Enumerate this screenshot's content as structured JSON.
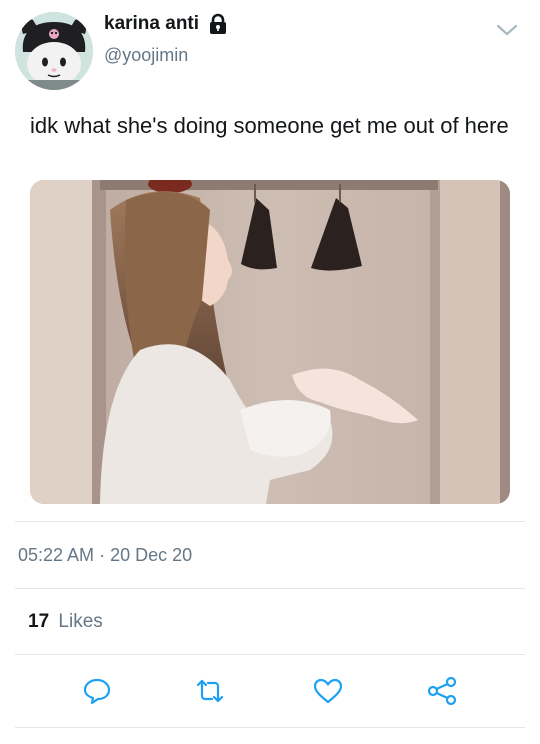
{
  "author": {
    "display_name": "karina anti",
    "handle": "@yoojimin",
    "protected_icon": "lock-icon",
    "avatar_icon": "kuromi-avatar"
  },
  "tweet": {
    "text": "idk what she's doing someone get me out of here",
    "media_description_icon": "photo"
  },
  "meta": {
    "time": "05:22 AM",
    "separator": "·",
    "date": "20 Dec 20"
  },
  "stats": {
    "likes_count": "17",
    "likes_label": "Likes"
  },
  "actions": [
    "reply-icon",
    "retweet-icon",
    "like-icon",
    "share-icon"
  ],
  "colors": {
    "text": "#14171a",
    "secondary": "#657786",
    "divider": "#e1e8ed",
    "icon": "#1da1f2"
  }
}
